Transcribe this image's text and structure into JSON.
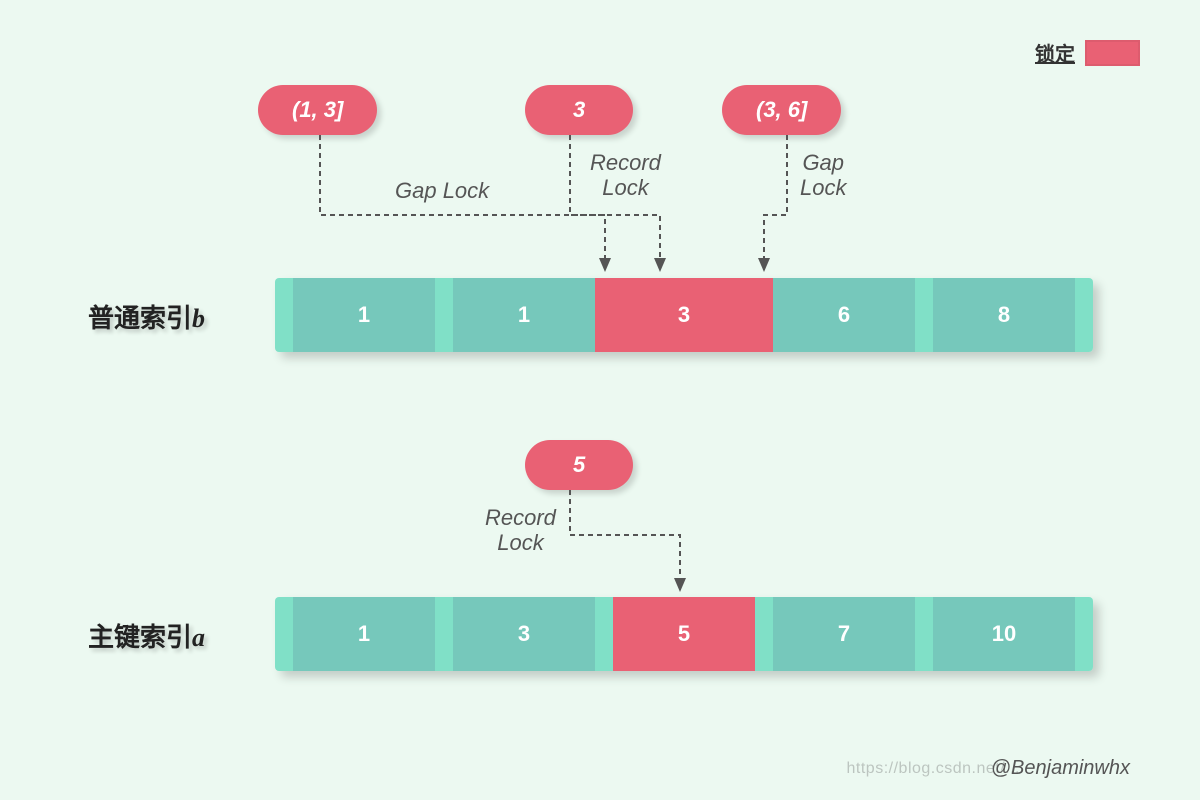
{
  "legend": {
    "label": "锁定"
  },
  "pills": {
    "p1": "(1, 3]",
    "p2": "3",
    "p3": "(3, 6]",
    "p4": "5"
  },
  "lock_labels": {
    "gap1": "Gap Lock",
    "rec1": "Record\nLock",
    "gap2": "Gap\nLock",
    "rec2": "Record\nLock"
  },
  "rows": {
    "b": {
      "label_prefix": "普通索引",
      "ident": "b",
      "cells": [
        "1",
        "1",
        "3",
        "6",
        "8"
      ]
    },
    "a": {
      "label_prefix": "主键索引",
      "ident": "a",
      "cells": [
        "1",
        "3",
        "5",
        "7",
        "10"
      ]
    }
  },
  "watermark": "@Benjaminwhx",
  "watermark2": "https://blog.csdn.net/... "
}
